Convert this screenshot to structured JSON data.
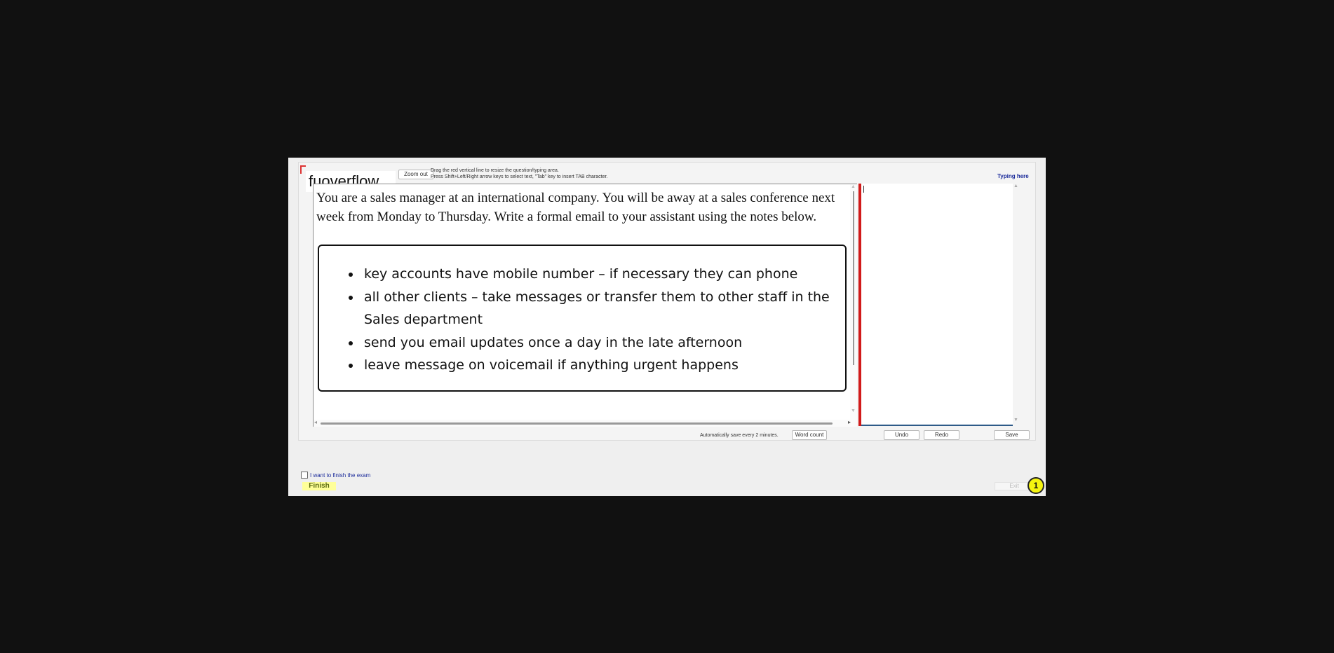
{
  "toolbar": {
    "logo_text": "fuoverflow",
    "zoom_out_label": "Zoom out",
    "instructions_line1": "Drag the red vertical line to resize the question/typing area.",
    "instructions_line2": "Press Shift+Left/Right arrow keys to select text, \"Tab\" key to insert TAB character.",
    "typing_here_label": "Typing here"
  },
  "question": {
    "prompt": "You are a sales manager at an international company. You will be away at a sales conference next week from Monday to Thursday. Write a formal email to your assistant using the notes below.",
    "notes": [
      "key accounts have mobile number – if necessary they can phone",
      "all other clients – take messages or transfer them to other staff in the Sales department",
      "send you email updates once a day in the late afternoon",
      "leave message on voicemail if anything urgent happens"
    ]
  },
  "typing_area": {
    "value": ""
  },
  "footer": {
    "autosave_text": "Automatically save every 2 minutes.",
    "word_count_label": "Word count",
    "undo_label": "Undo",
    "redo_label": "Redo",
    "save_label": "Save"
  },
  "exam": {
    "finish_checkbox_label": "I want to finish the exam",
    "finish_label": "Finish",
    "exit_label": "Exit",
    "badge_number": "1"
  },
  "colors": {
    "splitter": "#d11a1a",
    "finish_button_bg": "#ffff99",
    "badge_bg": "#f4f40f",
    "link_text": "#1a2a9a"
  }
}
